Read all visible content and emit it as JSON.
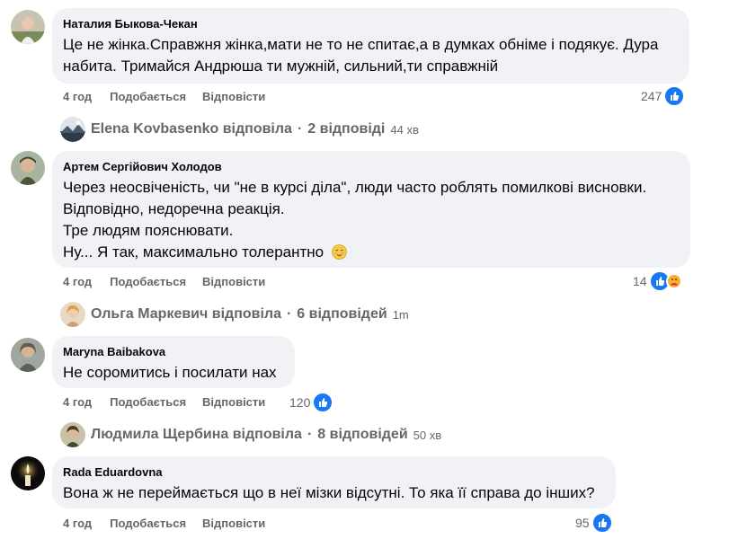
{
  "comments": [
    {
      "author": "Наталия Быкова-Чекан",
      "lines": [
        "Це не жінка.Справжня жінка,мати не то не спитає,а в думках обніме і подякує. Дура",
        "набита. Тримайся Андрюша ти мужній, сильний,ти справжній"
      ],
      "time": "4 год",
      "like_label": "Подобається",
      "reply_label": "Відповісти",
      "reaction_count": "247"
    },
    {
      "author": "Артем Сергійович Холодов",
      "lines": [
        "Через неосвіченість, чи \"не в курсі діла\", люди часто роблять помилкові висновки.",
        "Відповідно, недоречна реакція.",
        "Тре людям пояснювати.",
        "Ну... Я так, максимально толерантно"
      ],
      "time": "4 год",
      "like_label": "Подобається",
      "reply_label": "Відповісти",
      "reaction_count": "14"
    },
    {
      "author": "Maryna Baibakova",
      "lines": [
        "Не соромитись і посилати нах"
      ],
      "time": "4 год",
      "like_label": "Подобається",
      "reply_label": "Відповісти",
      "reaction_count": "120"
    },
    {
      "author": "Rada Eduardovna",
      "lines": [
        "Вона ж не переймається що в неї мізки відсутні. То яка її справа до інших?"
      ],
      "time": "4 год",
      "like_label": "Подобається",
      "reply_label": "Відповісти",
      "reaction_count": "95"
    }
  ],
  "replies": [
    {
      "name": "Elena Kovbasenko відповіла",
      "count": "2 відповіді",
      "time": "44 хв"
    },
    {
      "name": "Ольга Маркевич відповіла",
      "count": "6 відповідей",
      "time": "1m"
    },
    {
      "name": "Людмила Щербина відповіла",
      "count": "8 відповідей",
      "time": "50 хв"
    }
  ],
  "separator": "·",
  "icons": {
    "like": "thumbs-up-icon",
    "care": "care-emoji-icon",
    "smile": "blush-emoji-icon"
  },
  "colors": {
    "bubble": "#f0f2f5",
    "secondary_text": "#65676b",
    "like_blue": "#1877f2"
  }
}
